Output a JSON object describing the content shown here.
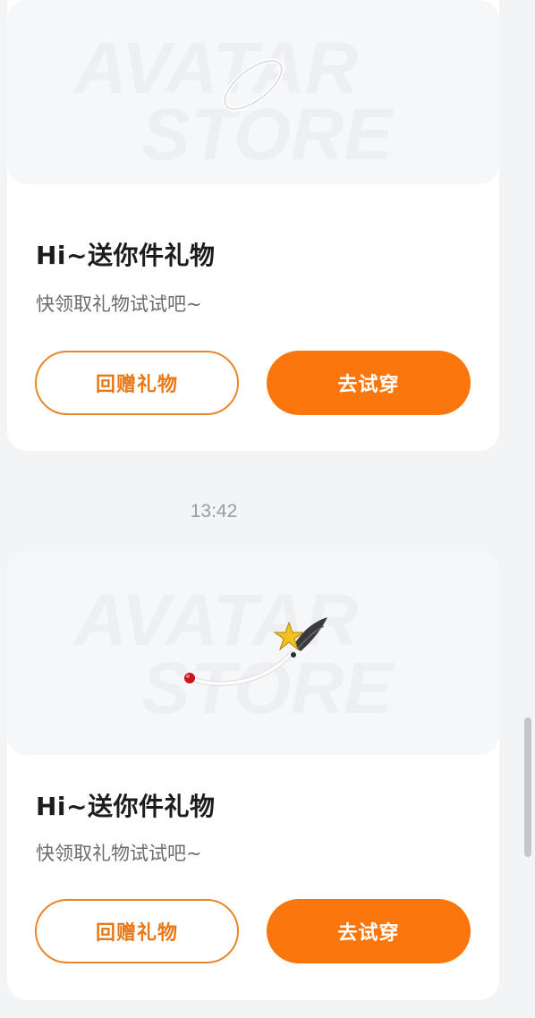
{
  "messages": [
    {
      "title": "Hi~送你件礼物",
      "subtitle": "快领取礼物试试吧~",
      "return_gift_label": "回赠礼物",
      "try_on_label": "去试穿",
      "watermark_line1": "AVATAR",
      "watermark_line2": "STORE",
      "gift_icon": "halo-icon"
    },
    {
      "title": "Hi~送你件礼物",
      "subtitle": "快领取礼物试试吧~",
      "return_gift_label": "回赠礼物",
      "try_on_label": "去试穿",
      "watermark_line1": "AVATAR",
      "watermark_line2": "STORE",
      "gift_icon": "star-wand-icon"
    }
  ],
  "timestamp": "13:42",
  "colors": {
    "accent": "#fb760c",
    "outline": "#e8862a",
    "background": "#f3f4f6"
  }
}
